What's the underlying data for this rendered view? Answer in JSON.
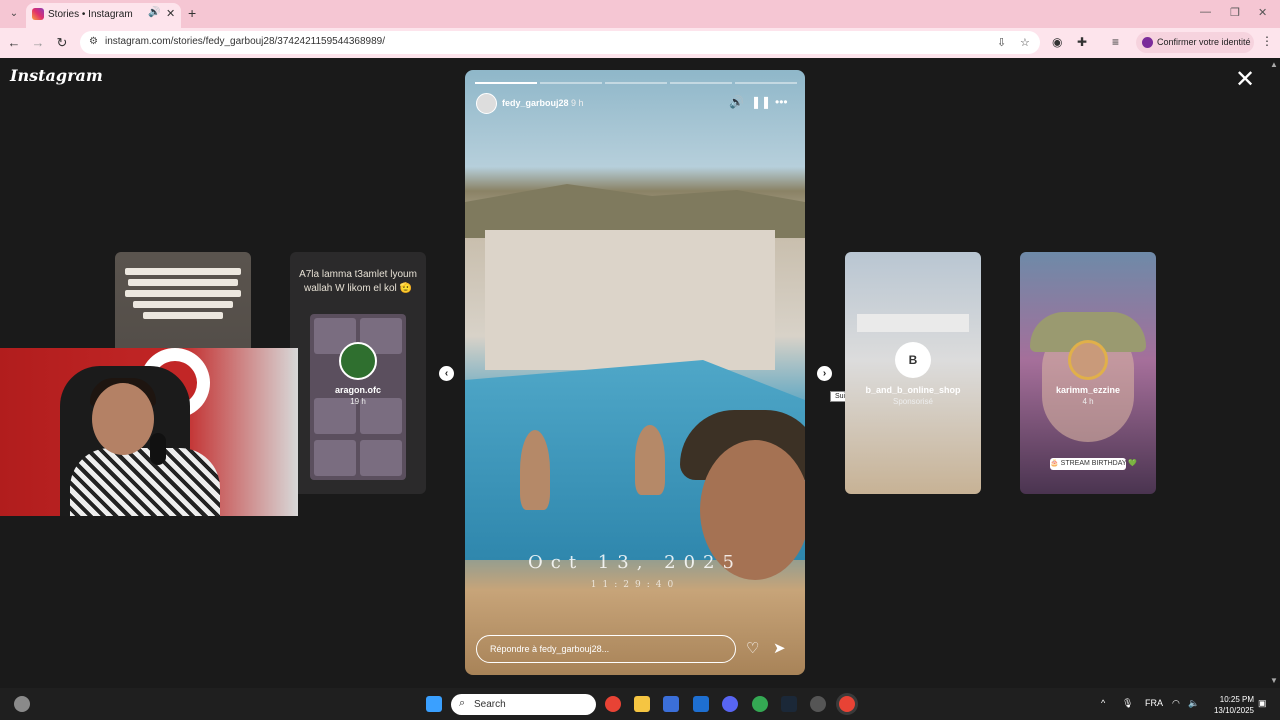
{
  "browser": {
    "tab_title": "Stories • Instagram",
    "url": "instagram.com/stories/fedy_garbouj28/3742421159544368989/",
    "profile_button": "Confirmer votre identité"
  },
  "viewer": {
    "logo": "Instagram",
    "prev_card_text": "A7la lamma t3amlet lyoum wallah W likom el kol 🫡",
    "cards": [
      {
        "name": "aragon.ofc",
        "sub": "19 h"
      },
      {
        "name": "b_and_b_online_shop",
        "sub": "Sponsorisé"
      },
      {
        "name": "karimm_ezzine",
        "sub": "4 h"
      }
    ],
    "card4_stamp": "🎂 STREAM BIRTHDAY 💚",
    "next_tooltip": "Suivant"
  },
  "story": {
    "username": "fedy_garbouj28",
    "time": "9 h",
    "date_stamp": "Oct 13, 2025",
    "time_stamp": "11:29:40",
    "reply_placeholder": "Répondre à fedy_garbouj28..."
  },
  "taskbar": {
    "search_label": "Search",
    "language": "FRA",
    "time": "10:25 PM",
    "date": "13/10/2025"
  }
}
